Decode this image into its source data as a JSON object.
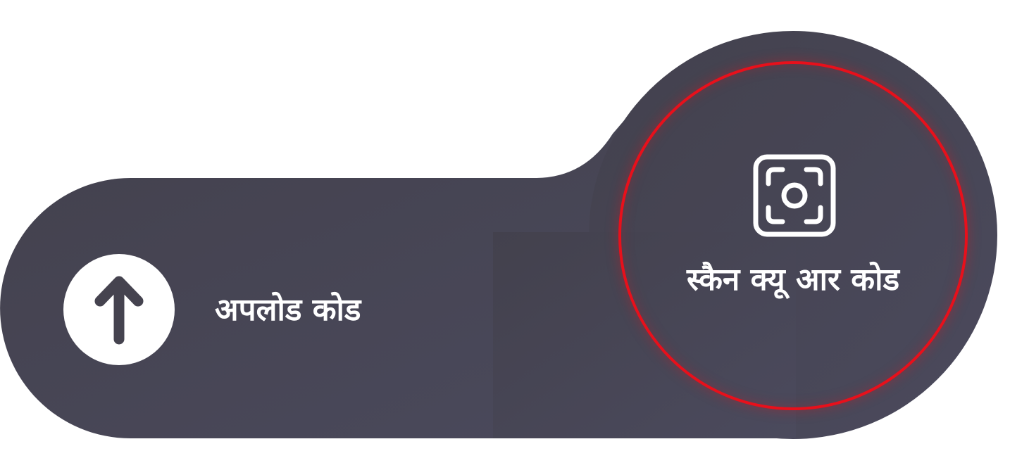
{
  "upload": {
    "label": "अपलोड कोड",
    "icon": "arrow-up-icon"
  },
  "scan": {
    "label": "स्कैन क्यू आर कोड",
    "icon": "camera-scan-icon",
    "highlighted": true
  },
  "colors": {
    "panel": "#45434f",
    "panel_light": "#4c4a5d",
    "text": "#ffffff",
    "highlight": "#e8101b"
  }
}
